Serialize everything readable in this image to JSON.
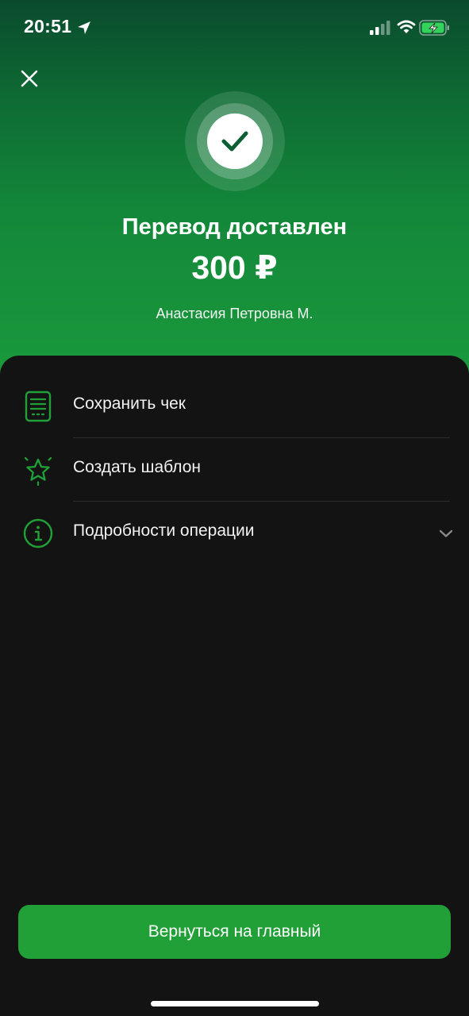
{
  "status_bar": {
    "time": "20:51",
    "icons": [
      "location-arrow-icon",
      "cellular-signal-icon",
      "wifi-icon",
      "battery-charging-icon"
    ]
  },
  "header": {
    "close_icon": "close-icon",
    "success_icon": "checkmark-icon",
    "title": "Перевод доставлен",
    "amount": "300 ₽",
    "recipient": "Анастасия Петровна М."
  },
  "actions": [
    {
      "label": "Сохранить чек",
      "icon": "receipt-icon"
    },
    {
      "label": "Создать шаблон",
      "icon": "star-icon"
    },
    {
      "label": "Подробности операции",
      "icon": "info-icon",
      "trailing_icon": "chevron-down-icon"
    }
  ],
  "footer": {
    "primary_button_label": "Вернуться на главный"
  },
  "colors": {
    "accent": "#21a038",
    "gradient_top": "#0a4a2e",
    "gradient_bottom": "#1a9a3c",
    "background": "#131313"
  }
}
